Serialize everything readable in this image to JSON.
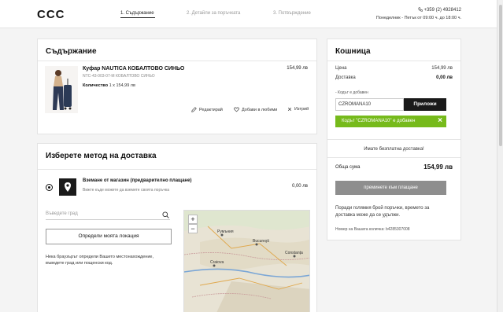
{
  "header": {
    "logo": "CCC",
    "steps": [
      "1. Съдържание",
      "2. Детайли за поръчката",
      "3. Потвърждение"
    ],
    "phone": "+359 (2) 4928412",
    "hours": "Понеделник - Петък от 09:00 ч. до 18:00 ч."
  },
  "content": {
    "title": "Съдържание",
    "product": {
      "name": "Куфар NAUTICA КОБАЛТОВО СИНЬО",
      "code": "NTC-43-003-07-M КОБАЛТОВО СИНЬО",
      "qty_label": "Количество",
      "qty_value": "1 x 154,99 лв",
      "price": "154,99 лв"
    },
    "actions": {
      "edit": "Редактирай",
      "favorite": "Добави в любими",
      "remove": "Изтрий"
    }
  },
  "delivery": {
    "title": "Изберете метод на доставка",
    "option_title": "Вземане от магазин (предварително плащане)",
    "option_sub": "Вижте къде можете да вземете своята поръчка",
    "option_price": "0,00 лв",
    "search_placeholder": "Въведете град",
    "locate_button": "Определи моята локация",
    "hint": "Нека браузърът определи Вашето местонахождение, въведете град или пощенски код.",
    "map_labels": {
      "city1": "Bucureşti",
      "city2": "Румъния",
      "city3": "Craiova",
      "city4": "Constanța"
    }
  },
  "cart": {
    "title": "Кошница",
    "price_label": "Цена",
    "price_value": "154,99 лв",
    "shipping_label": "Доставка",
    "shipping_value": "0,00 лв",
    "coupon_label": "- Кодът е добавен",
    "coupon_value": "CZROMANA10",
    "apply_button": "Приложи",
    "coupon_added": "Кодът \"CZROMANA10\" е добавен",
    "free_shipping": "Имате безплатна доставка!",
    "total_label": "Обща сума",
    "total_value": "154,99 лв",
    "pay_button": "преминете към плащане",
    "note": "Поради голямия брой поръчки, времето за доставка може да се удължи.",
    "cart_number": "Номер на Вашата количка: b4285307008"
  },
  "colors": {
    "success": "#76ba1b",
    "dark": "#1a1a1a",
    "disabled": "#8e8e8e"
  }
}
